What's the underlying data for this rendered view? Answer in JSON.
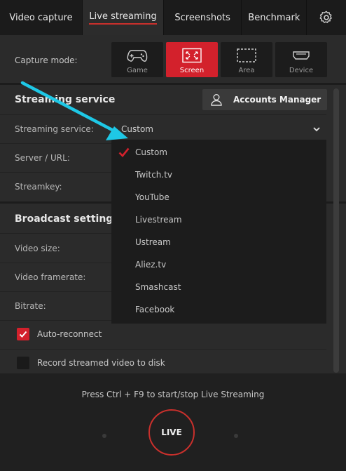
{
  "tabs": {
    "video_capture": "Video capture",
    "live_streaming": "Live streaming",
    "screenshots": "Screenshots",
    "benchmark": "Benchmark"
  },
  "capture": {
    "label": "Capture mode:",
    "modes": [
      "Game",
      "Screen",
      "Area",
      "Device"
    ],
    "selected": "Screen"
  },
  "streaming": {
    "title": "Streaming service",
    "accounts_button": "Accounts Manager",
    "service_label": "Streaming service:",
    "server_label": "Server / URL:",
    "streamkey_label": "Streamkey:",
    "selected_value": "Custom",
    "options": [
      "Custom",
      "Twitch.tv",
      "YouTube",
      "Livestream",
      "Ustream",
      "Aliez.tv",
      "Smashcast",
      "Facebook"
    ]
  },
  "broadcast": {
    "title": "Broadcast settings",
    "video_size_label": "Video size:",
    "video_framerate_label": "Video framerate:",
    "bitrate_label": "Bitrate:",
    "auto_reconnect": "Auto-reconnect",
    "auto_reconnect_checked": true,
    "record_disk": "Record streamed video to disk",
    "record_disk_checked": false
  },
  "footer": {
    "hint": "Press Ctrl + F9 to start/stop Live Streaming",
    "live_button": "LIVE"
  },
  "colors": {
    "accent": "#d3212c",
    "annotation_arrow": "#1ec8e6"
  },
  "icons": {
    "settings": "gear-icon",
    "accounts": "person-icon",
    "game": "gamepad-icon",
    "screen": "screen-expand-icon",
    "area": "area-select-icon",
    "device": "hdmi-device-icon",
    "dropdown": "chevron-down-icon",
    "selected_option": "checkmark-icon"
  }
}
